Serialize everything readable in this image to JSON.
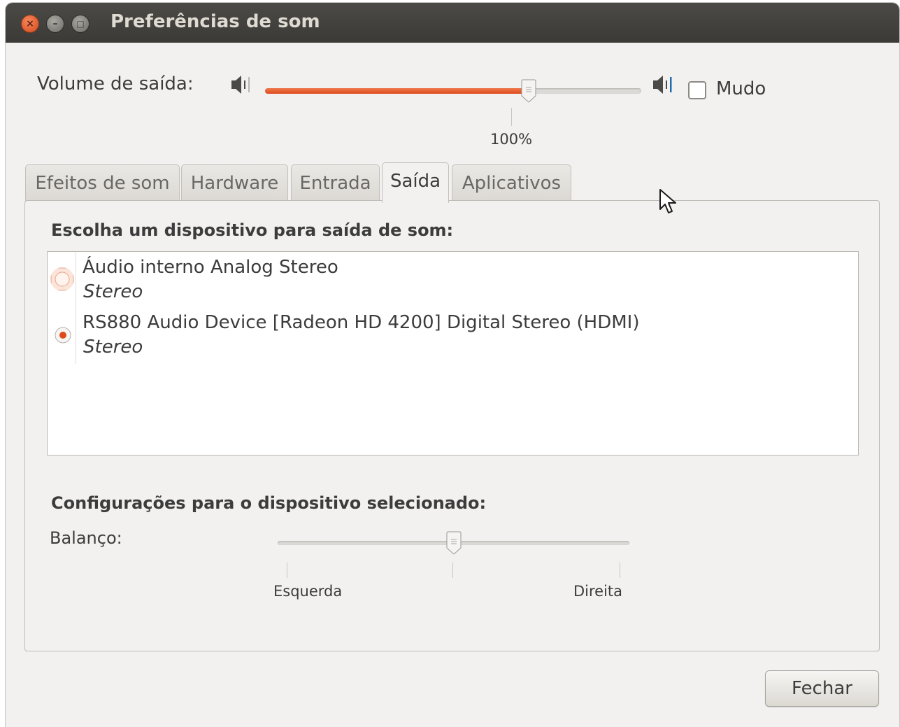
{
  "window": {
    "title": "Preferências de som",
    "close_glyph": "×",
    "minimize_glyph": "–",
    "maximize_glyph": "□"
  },
  "output_volume": {
    "label": "Volume de saída:",
    "value_percent": 70,
    "value_label": "100%",
    "mute_label": "Mudo",
    "mute_checked": false
  },
  "tabs": [
    {
      "label": "Efeitos de som",
      "active": false
    },
    {
      "label": "Hardware",
      "active": false
    },
    {
      "label": "Entrada",
      "active": false
    },
    {
      "label": "Saída",
      "active": true
    },
    {
      "label": "Aplicativos",
      "active": false
    }
  ],
  "output": {
    "heading": "Escolha um dispositivo para saída de som:",
    "devices": [
      {
        "name": "Áudio interno Analog Stereo",
        "profile": "Stereo",
        "selected": false
      },
      {
        "name": "RS880 Audio Device [Radeon HD 4200] Digital Stereo (HDMI)",
        "profile": "Stereo",
        "selected": true
      }
    ]
  },
  "settings": {
    "heading": "Configurações para o dispositivo selecionado:",
    "balance_label": "Balanço:",
    "balance_value": 0.5,
    "left_label": "Esquerda",
    "right_label": "Direita"
  },
  "close_button": "Fechar",
  "colors": {
    "accent": "#dd4b1d",
    "titlebar": "#3f3e3a",
    "window_bg": "#f2f1f0"
  }
}
